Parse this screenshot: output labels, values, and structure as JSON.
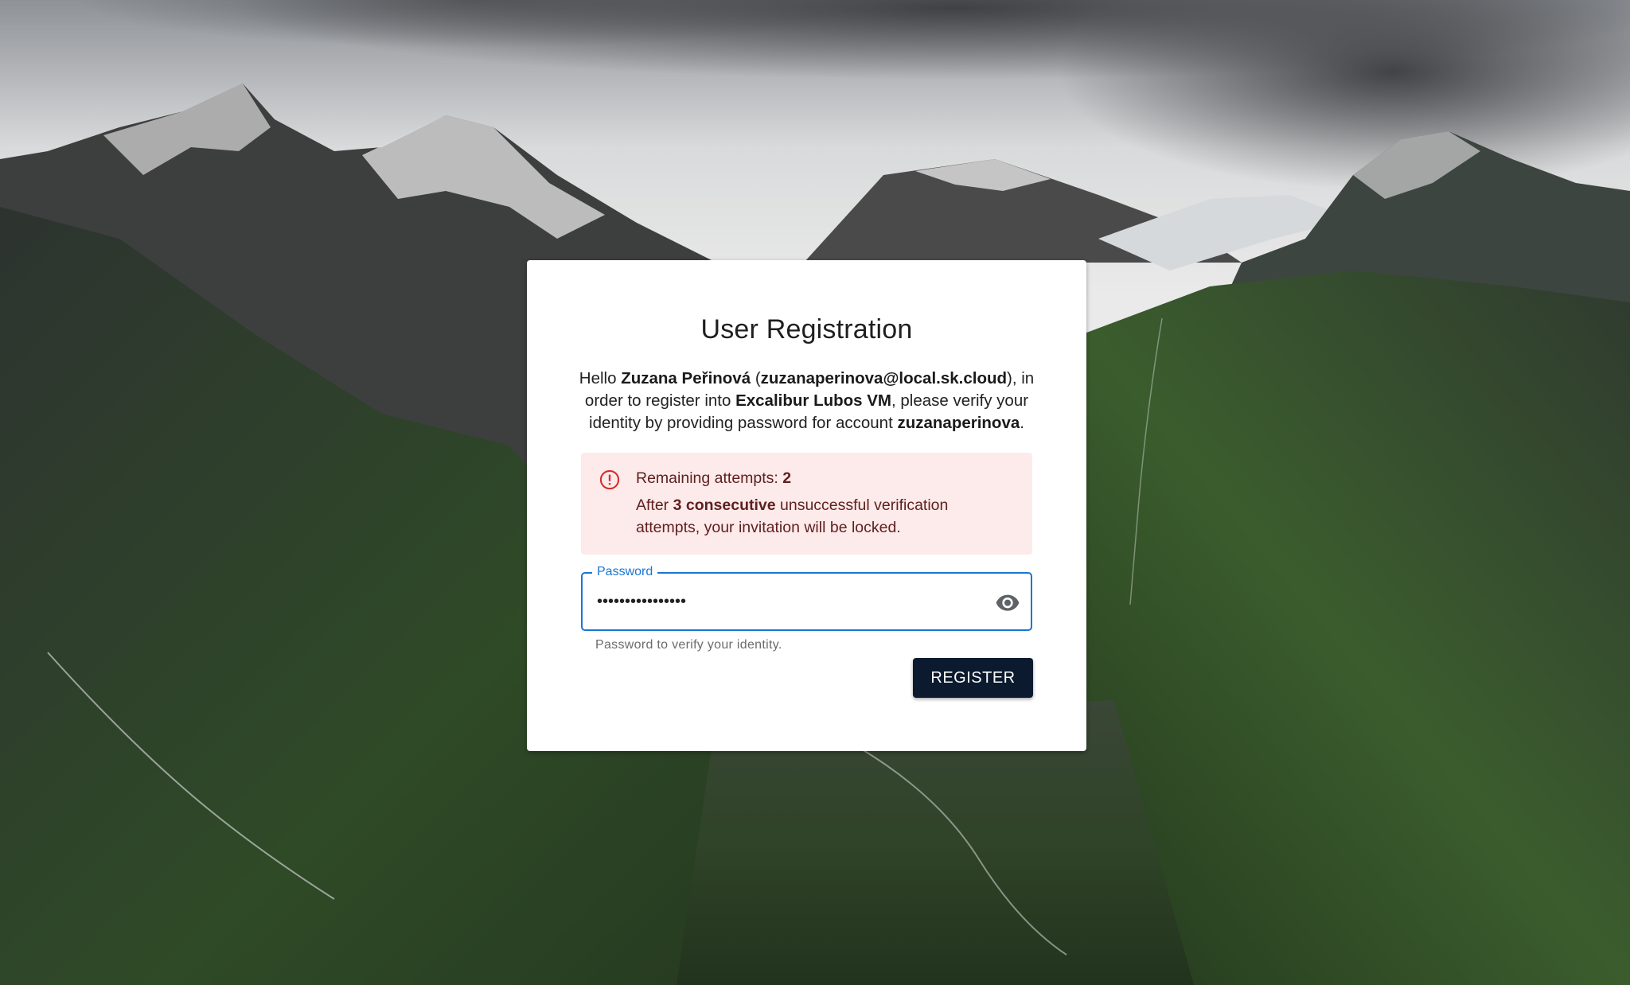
{
  "page": {
    "title": "User Registration",
    "background": "mountain-landscape-photo"
  },
  "intro": {
    "greeting": "Hello ",
    "user_name": "Zuzana Peřinová",
    "open_paren": " (",
    "user_email": "zuzanaperinova@local.sk.cloud",
    "after_email": "), in order to register into ",
    "target": "Excalibur Lubos VM",
    "after_target": ", please verify your identity by providing password for account ",
    "account": "zuzanaperinova",
    "end": "."
  },
  "alert": {
    "icon": "error-outline-icon",
    "remaining_label": "Remaining attempts: ",
    "remaining_value": "2",
    "after_prefix": "After ",
    "consecutive": "3 consecutive",
    "after_suffix": " unsuccessful verification attempts, your invitation will be locked.",
    "color_bg": "#fdeaea",
    "color_icon": "#d32f2f"
  },
  "password_field": {
    "label": "Password",
    "value": "••••••••••••••••",
    "helper": "Password to verify your identity.",
    "toggle_icon": "eye-icon",
    "accent": "#1976d2"
  },
  "register_button": {
    "label": "REGISTER",
    "color": "#0b1a2e"
  }
}
